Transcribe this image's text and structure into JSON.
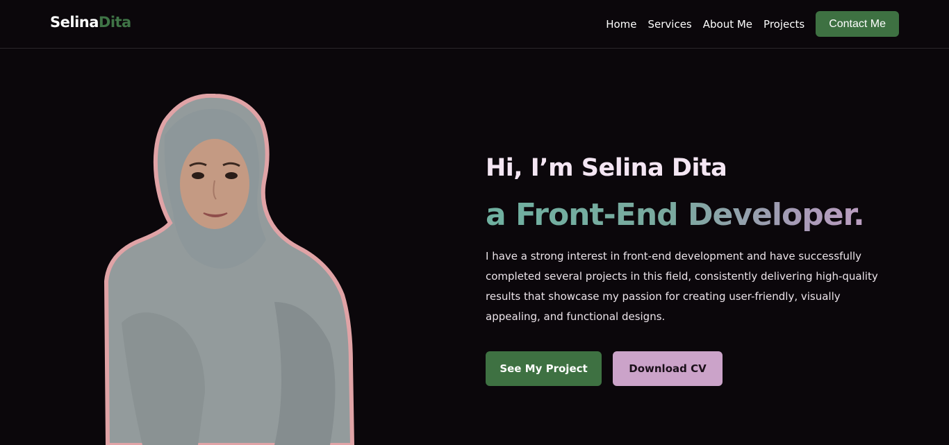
{
  "header": {
    "logo": {
      "first": "Selina",
      "second": "Dita"
    },
    "nav": [
      "Home",
      "Services",
      "About Me",
      "Projects"
    ],
    "contact_label": "Contact Me"
  },
  "hero": {
    "greeting": "Hi, I’m Selina Dita",
    "role": "a Front-End Developer.",
    "description": "I have a strong interest in front-end development and have successfully completed several projects in this field, consistently delivering high-quality results that showcase my passion for creating user-friendly, visually appealing, and functional designs.",
    "primary_cta": "See My Project",
    "secondary_cta": "Download CV"
  },
  "colors": {
    "background": "#0b070b",
    "brand_green": "#3e7142",
    "accent_pink": "#cba3c9",
    "teal": "#6fb0a0"
  }
}
